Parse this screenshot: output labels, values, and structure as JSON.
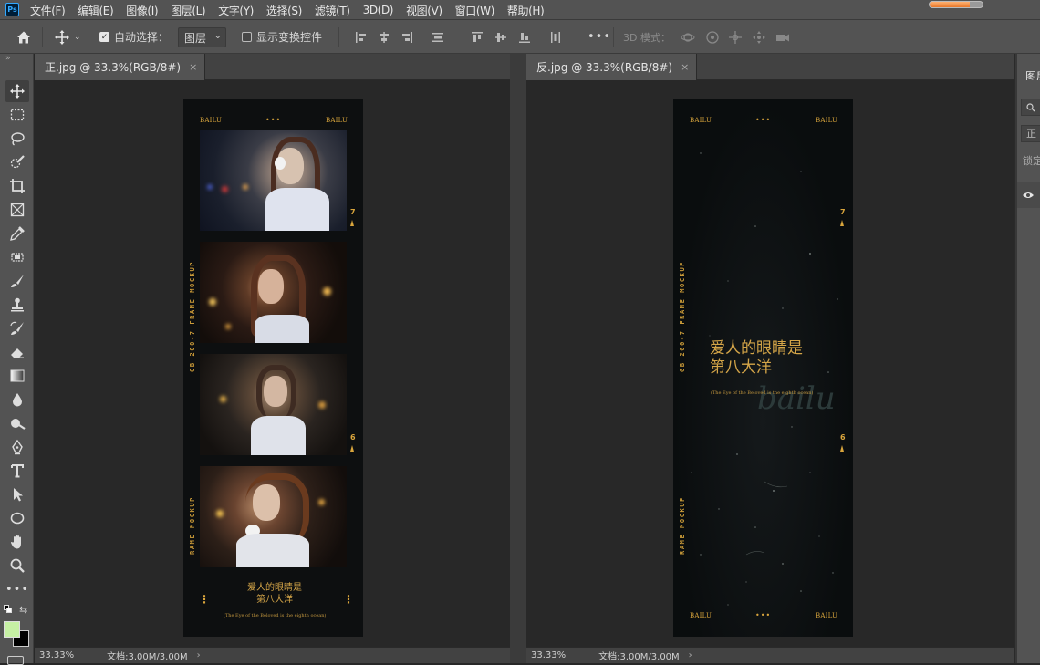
{
  "app": {
    "logo": "Ps"
  },
  "menu": [
    "文件(F)",
    "编辑(E)",
    "图像(I)",
    "图层(L)",
    "文字(Y)",
    "选择(S)",
    "滤镜(T)",
    "3D(D)",
    "视图(V)",
    "窗口(W)",
    "帮助(H)"
  ],
  "progress": {
    "value": 0.75
  },
  "options": {
    "auto_select_label": "自动选择：",
    "auto_select_checked": true,
    "layer_select_value": "图层",
    "show_transform_label": "显示变换控件",
    "more_label": "•••",
    "mode_3d_label": "3D 模式："
  },
  "documents": [
    {
      "tab_title": "正.jpg @ 33.3%(RGB/8#)",
      "close": "×",
      "zoom": "33.33%",
      "doc_info": "文档:3.00M/3.00M",
      "arrow": "›",
      "strip": {
        "top_left": "BAILU",
        "top_right": "BAILU",
        "dots": "•••",
        "vertical_text_1": "GB 200-7 FRAME MOCKUP",
        "vertical_text_2": "RAME MOCKUP",
        "num_top": "7",
        "num_bottom": "6",
        "cn_title": [
          "爱人的眼睛是",
          "第八大洋"
        ],
        "en_sub": "(The Eye of the Beloved is the eighth ocean)",
        "side_dots": "⋮"
      }
    },
    {
      "tab_title": "反.jpg @ 33.3%(RGB/8#)",
      "close": "×",
      "zoom": "33.33%",
      "doc_info": "文档:3.00M/3.00M",
      "arrow": "›",
      "strip": {
        "top_left": "BAILU",
        "top_right": "BAILU",
        "dots": "•••",
        "bottom_left": "BAILU",
        "bottom_right": "BAILU",
        "vertical_text_1": "GB 200-7 FRAME MOCKUP",
        "vertical_text_2": "RAME MOCKUP",
        "num_top": "7",
        "num_bottom": "6",
        "cn_title": [
          "爱人的眼睛是",
          "第八大洋"
        ],
        "en_sub": "(The Eye of the Beloved is the eighth ocean)",
        "script_signature": "bailu"
      }
    }
  ],
  "right_panel": {
    "tab": "图层",
    "kind_field": "正",
    "lock_label": "锁定"
  },
  "colors": {
    "accent_gold": "#d9a53c",
    "foreground_swatch": "#c6f0a4",
    "background_swatch": "#000000"
  }
}
